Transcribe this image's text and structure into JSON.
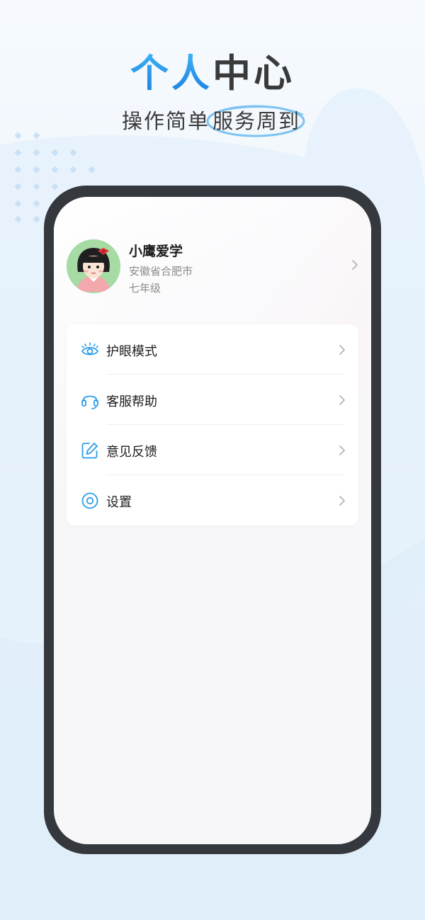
{
  "promo": {
    "title_blue": "个人",
    "title_dark": "中心",
    "subtitle_plain": "操作简单",
    "subtitle_highlight": "服务周到"
  },
  "profile": {
    "name": "小鹰爱学",
    "location": "安徽省合肥市",
    "grade": "七年级"
  },
  "menu": {
    "items": [
      {
        "icon": "eye-icon",
        "label": "护眼模式"
      },
      {
        "icon": "headset-icon",
        "label": "客服帮助"
      },
      {
        "icon": "edit-icon",
        "label": "意见反馈"
      },
      {
        "icon": "settings-icon",
        "label": "设置"
      }
    ]
  },
  "colors": {
    "accent_blue": "#2a9de8",
    "phone_frame": "#35383d",
    "text_primary": "#1e1e1e",
    "text_secondary": "#8a8a8a"
  }
}
